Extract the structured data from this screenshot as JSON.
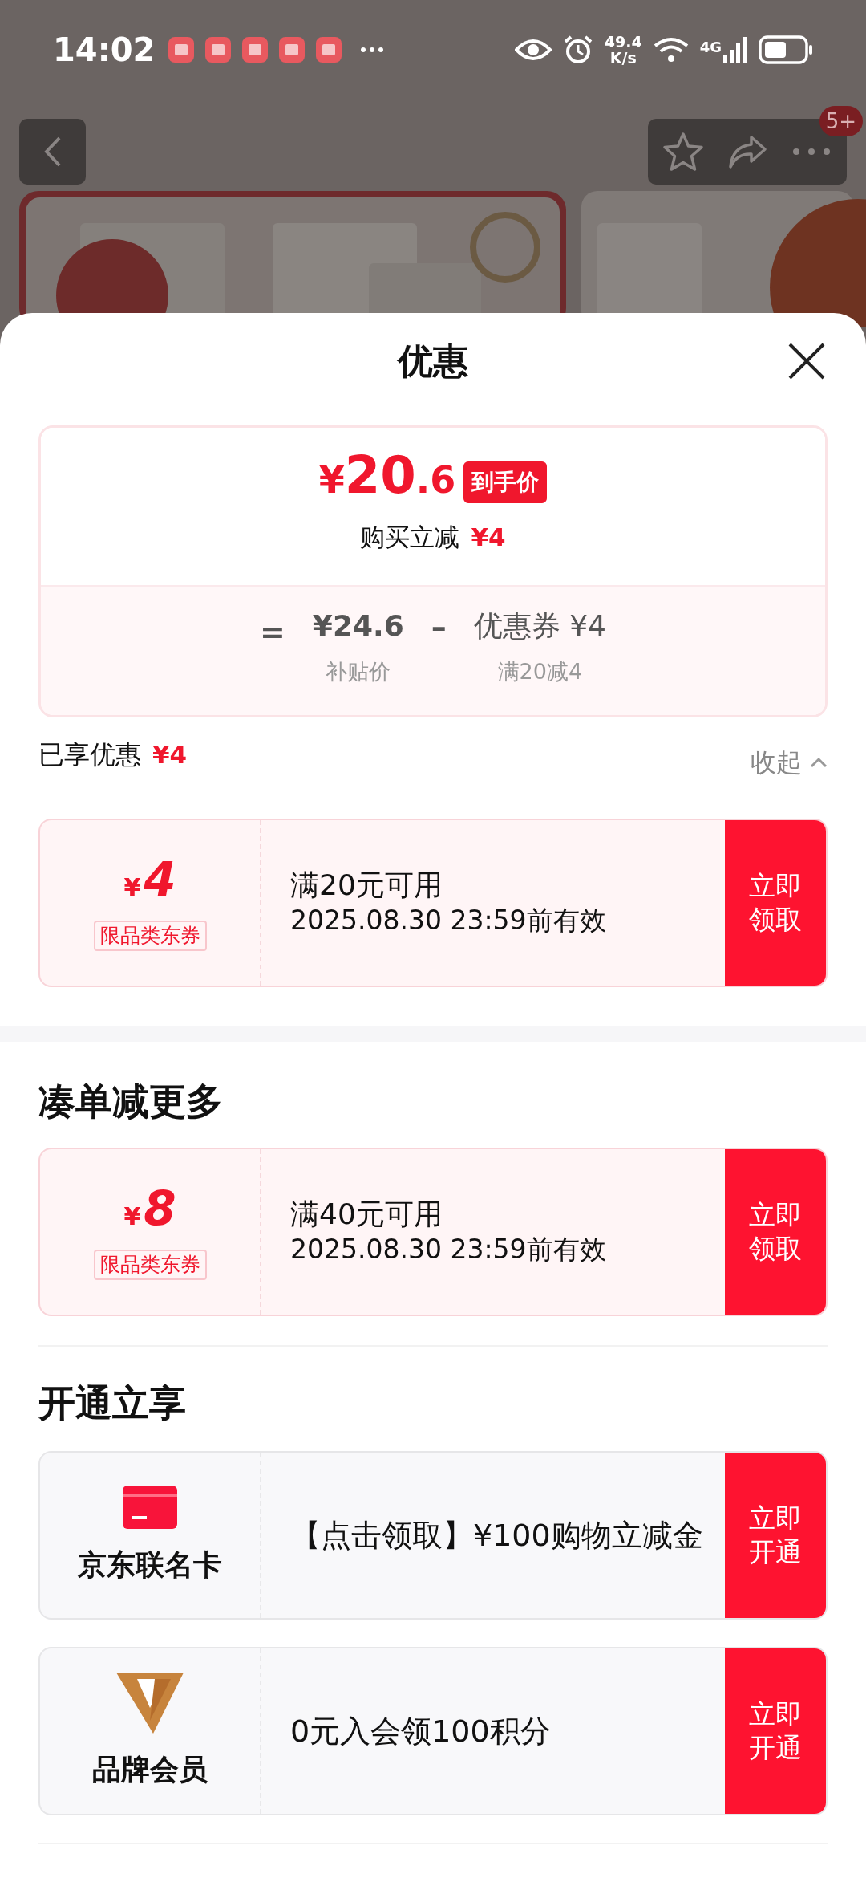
{
  "status_bar": {
    "time": "14:02",
    "net_speed_value": "49.4",
    "net_speed_unit": "K/s",
    "network": "4G"
  },
  "nav": {
    "badge": "5+"
  },
  "sheet": {
    "title": "优惠",
    "summary": {
      "price_symbol": "¥",
      "price_int": "20",
      "price_dec": ".6",
      "price_tag": "到手价",
      "cut_label": "购买立减",
      "cut_amount": "¥4",
      "formula": {
        "equals": "=",
        "base_price": "¥24.6",
        "base_label": "补贴价",
        "minus": "–",
        "discount": "优惠券 ¥4",
        "discount_rule": "满20减4"
      }
    },
    "enjoyed": {
      "label": "已享优惠",
      "amount": "¥4",
      "collapse": "收起"
    },
    "enjoyed_coupons": [
      {
        "symbol": "¥",
        "amount": "4",
        "tag": "限品类东券",
        "condition": "满20元可用",
        "validity": "2025.08.30 23:59前有效",
        "button": "立即领取"
      }
    ],
    "more_section": {
      "title": "凑单减更多",
      "coupons": [
        {
          "symbol": "¥",
          "amount": "8",
          "tag": "限品类东券",
          "condition": "满40元可用",
          "validity": "2025.08.30 23:59前有效",
          "button": "立即领取"
        }
      ]
    },
    "join_section": {
      "title": "开通立享",
      "offers": [
        {
          "kind": "card",
          "name": "京东联名卡",
          "text": "【点击领取】¥100购物立减金",
          "button": "立即开通"
        },
        {
          "kind": "member",
          "name": "品牌会员",
          "text": "0元入会领100积分",
          "button": "立即开通"
        }
      ]
    }
  }
}
